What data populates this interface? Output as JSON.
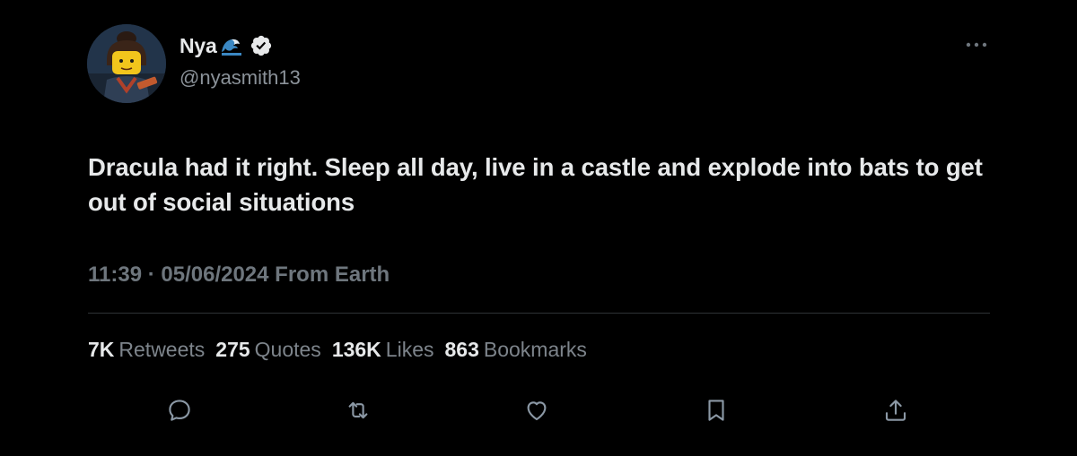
{
  "user": {
    "display_name": "Nya",
    "name_emoji": "wave-emoji",
    "verified": true,
    "handle": "@nyasmith13"
  },
  "tweet": {
    "text": "Dracula had it right. Sleep all day, live in a castle and explode into bats to get out of social situations",
    "meta": "11:39 · 05/06/2024 From Earth"
  },
  "stats": [
    {
      "count": "7K",
      "label": "Retweets"
    },
    {
      "count": "275",
      "label": "Quotes"
    },
    {
      "count": "136K",
      "label": "Likes"
    },
    {
      "count": "863",
      "label": "Bookmarks"
    }
  ],
  "actions": [
    {
      "icon": "reply-icon"
    },
    {
      "icon": "retweet-icon"
    },
    {
      "icon": "like-icon"
    },
    {
      "icon": "bookmark-icon"
    },
    {
      "icon": "share-icon"
    }
  ],
  "colors": {
    "background": "#000000",
    "primary_text": "#e7e9ea",
    "secondary_text": "#71767b",
    "divider": "#2f3336",
    "icon": "#8b98a5"
  }
}
